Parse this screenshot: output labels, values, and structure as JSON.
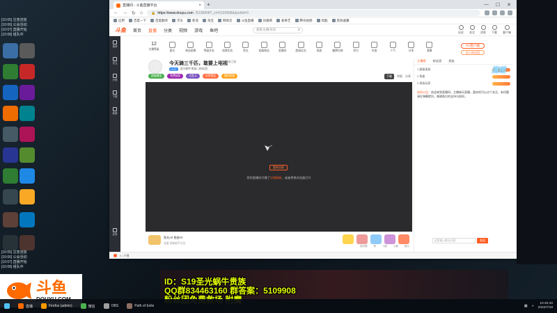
{
  "browser": {
    "tab_title": "直播间 - 斗鱼直播平台",
    "url_host": "https://www.douyu.com",
    "url_path": "/5109908?_ct=5109908&dyshid=0",
    "bookmarks": [
      "应用",
      "百度一下",
      "百度翻译",
      "京东",
      "新浪",
      "淘宝",
      "网易云",
      "斗鱼直播",
      "凤凰网",
      "爱奇艺",
      "腾讯视频",
      "优酷",
      "其他收藏"
    ],
    "status_text": "0 | 开播"
  },
  "site": {
    "logo": "斗鱼",
    "nav": [
      "首页",
      "直播",
      "分类",
      "视频",
      "游戏",
      "鱼吧"
    ],
    "search_placeholder": "搜索主播/房间",
    "header_icons": [
      "历史",
      "关注",
      "消息",
      "下载",
      "客户端"
    ],
    "sidebar": [
      "推荐",
      "关注",
      "分类",
      "下载",
      "客服",
      "反馈"
    ],
    "categories": [
      {
        "label": "主播等级",
        "count": "12"
      },
      {
        "label": "星光"
      },
      {
        "label": "粉丝勋章"
      },
      {
        "label": "等级任务"
      },
      {
        "label": "成就任务"
      },
      {
        "label": "鱼丸"
      },
      {
        "label": "超级粉丝"
      },
      {
        "label": "直播间"
      },
      {
        "label": "超级礼包"
      },
      {
        "label": "贵族"
      },
      {
        "label": "翻牌礼物"
      },
      {
        "label": "积分"
      },
      {
        "label": "年度"
      },
      {
        "label": "人气"
      },
      {
        "label": "分享"
      },
      {
        "label": "赛事"
      }
    ],
    "pc_button": "PC客户端",
    "pc_button2": "加入粉丝团"
  },
  "room": {
    "title": "今天骑三千匹，敢要上电视",
    "tag": "网游 › 流放之路",
    "level": "Lv21",
    "meta": "圣光蜗牛贵族  |  粉丝团",
    "pills": [
      "超值赠送",
      "免费抽奖",
      "大乱斗",
      "分享得宝",
      "福利发放"
    ],
    "download": "下载",
    "report": "举报",
    "share": "分享"
  },
  "player": {
    "button": "重新加载",
    "tip_prefix": "您的直播间开播了",
    "tip_link": "点我刷新",
    "tip_suffix": "，或者更换浏览器打开"
  },
  "giftbar": {
    "title": "鱼丸×0  鱼翅×0",
    "sub": "充值 领取新手礼包",
    "labels": [
      "荧光棒",
      "赞",
      "飞机",
      "火箭",
      "超火"
    ]
  },
  "chat": {
    "tabs": [
      "主播榜",
      "粉丝团",
      "贵族"
    ],
    "rank_rows": [
      "1  超级贵族",
      "2  鱼翅",
      "3  贵族玩家"
    ],
    "notice_title": "房间公告：",
    "notice": "欢迎来到直播间，主播每天直播，喜欢的可以点个关注，有问题请在弹幕提问，感谢各位的支持与陪伴。",
    "input_placeholder": "这里输入聊天内容",
    "send": "发送"
  },
  "overlay": {
    "line1": "ID：S19圣光蜗牛贵族",
    "line2": "QQ群834463160  群答案：5109908",
    "line3": "粉丝团免费救场 附魔"
  },
  "douyu": {
    "cn": "斗鱼",
    "en": "DOUYU.COM"
  },
  "taskbar": {
    "tasks": [
      "直播",
      "Firefox (admin)",
      "微信",
      "OBS",
      "Path of Exile"
    ],
    "time": "10:40:40",
    "date": "2022/7/18"
  },
  "desktop_left": [
    "[10:05] 注意流放",
    "[10:06] 公会活动",
    "[10:07] 直播开始",
    "[10:08] 组队中"
  ]
}
